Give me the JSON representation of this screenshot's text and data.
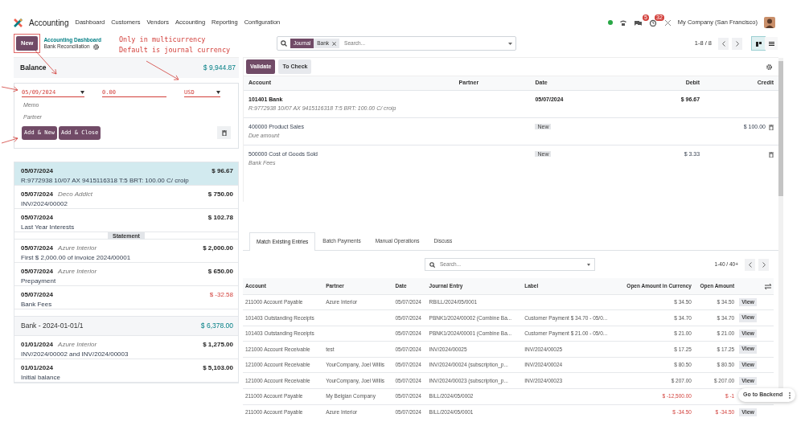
{
  "navbar": {
    "app": "Accounting",
    "menu": [
      "Dashboard",
      "Customers",
      "Vendors",
      "Accounting",
      "Reporting",
      "Configuration"
    ],
    "messages_badge": "5",
    "activities_badge": "32",
    "company": "My Company (San Francisco)"
  },
  "control_panel": {
    "new_button": "New",
    "breadcrumb": "Accounting Dashboard",
    "title": "Bank Reconciliation",
    "search": {
      "facet_label": "Journal",
      "facet_value": "Bank",
      "placeholder": "Search..."
    },
    "pager": "1-8 / 8",
    "views": [
      {
        "kind": "kanban",
        "selected": true
      },
      {
        "kind": "list",
        "selected": false
      }
    ]
  },
  "annotations": [
    "Only in multicurrency",
    "Default is journal currency"
  ],
  "balance": {
    "label": "Balance",
    "amount": "$ 9,944.87"
  },
  "new_line_form": {
    "date": "05/09/2024",
    "amount": "0.00",
    "currency": "USD",
    "memo_placeholder": "Memo",
    "partner_placeholder": "Partner",
    "buttons": [
      "Add & New",
      "Add & Close"
    ]
  },
  "statement_groups": [
    {
      "lines": [
        {
          "date": "05/07/2024",
          "label": "R:9772938 10/07 AX 9415116318 T:5 BRT: 100.00 C/ croip",
          "amount": "$ 96.67",
          "negative": false,
          "selected": true
        },
        {
          "date": "05/07/2024",
          "partner": "Deco Addict",
          "label": "INV/2024/00002",
          "amount": "$ 750.00",
          "negative": false,
          "selected": false
        },
        {
          "date": "05/07/2024",
          "label": "Last Year Interests",
          "amount": "$ 102.78",
          "negative": false,
          "selected": false
        },
        {
          "date": "05/07/2024",
          "partner": "Azure Interior",
          "label": "First $ 2,000.00 of invoice 2024/00001",
          "amount": "$ 2,000.00",
          "negative": false,
          "selected": false,
          "separator": "Statement"
        },
        {
          "date": "05/07/2024",
          "partner": "Azure Interior",
          "label": "Prepayment",
          "amount": "$ 650.00",
          "negative": false,
          "selected": false
        },
        {
          "date": "05/07/2024",
          "label": "Bank Fees",
          "amount": "$ -32.58",
          "negative": true,
          "selected": false
        }
      ]
    },
    {
      "name": "Bank - 2024-01-01/1",
      "total": "$ 6,378.00",
      "lines": [
        {
          "date": "01/01/2024",
          "partner": "Azure Interior",
          "label": "INV/2024/00002 and INV/2024/00003",
          "amount": "$ 1,275.00",
          "negative": false,
          "selected": false
        },
        {
          "date": "01/01/2024",
          "label": "Initial balance",
          "amount": "$ 5,103.00",
          "negative": false,
          "selected": false
        }
      ]
    }
  ],
  "reconcile": {
    "buttons": [
      {
        "label": "Validate",
        "kind": "primary"
      },
      {
        "label": "To Check",
        "kind": "secondary"
      }
    ],
    "columns": [
      "Account",
      "Partner",
      "Date",
      "Debit",
      "Credit"
    ],
    "lines": [
      {
        "account": "101401 Bank",
        "label": "R:9772938 10/07 AX 9415116318 T:5 BRT: 100.00 C/ croip",
        "date": "05/07/2024",
        "debit": "$ 96.67",
        "bold": true,
        "deletable": false
      },
      {
        "account": "400000 Product Sales",
        "label": "Due amount",
        "tag": "New",
        "credit": "$ 100.00",
        "bold": false,
        "deletable": true
      },
      {
        "account": "500000 Cost of Goods Sold",
        "label": "Bank Fees",
        "tag": "New",
        "debit": "$ 3.33",
        "bold": false,
        "deletable": true
      }
    ]
  },
  "tabs": [
    {
      "label": "Match Existing Entries",
      "selected": true
    },
    {
      "label": "Batch Payments",
      "selected": false
    },
    {
      "label": "Manual Operations",
      "selected": false
    },
    {
      "label": "Discuss",
      "selected": false
    }
  ],
  "match": {
    "search_placeholder": "Search...",
    "pager": "1-40 / 40+",
    "columns": [
      "Account",
      "Partner",
      "Date",
      "Journal Entry",
      "Label",
      "Open Amount in Currency",
      "Open Amount"
    ],
    "rows": [
      {
        "account": "211000 Account Payable",
        "partner": "Azure Interior",
        "date": "05/07/2024",
        "entry": "RBILL/2024/05/0001",
        "amount_currency": "$ 34.50",
        "amount": "$ 34.50",
        "negative": false,
        "view": "View"
      },
      {
        "account": "101403 Outstanding Receipts",
        "date": "05/07/2024",
        "entry": "PBNK1/2024/00002 (Combine Ba...",
        "label": "Customer Payment $ 34.70 - 05/0...",
        "amount_currency": "$ 34.70",
        "amount": "$ 34.70",
        "negative": false,
        "view": "View"
      },
      {
        "account": "101403 Outstanding Receipts",
        "date": "05/07/2024",
        "entry": "PBNK1/2024/00001 (Combine Ba...",
        "label": "Customer Payment $ 21.00 - 05/0...",
        "amount_currency": "$ 21.00",
        "amount": "$ 21.00",
        "negative": false,
        "view": "View"
      },
      {
        "account": "121000 Account Receivable",
        "partner": "test",
        "date": "05/07/2024",
        "entry": "INV/2024/00025",
        "label": "INV/2024/00025",
        "amount_currency": "$ 17.25",
        "amount": "$ 17.25",
        "negative": false,
        "view": "View"
      },
      {
        "account": "121000 Account Receivable",
        "partner": "YourCompany, Joel Willis",
        "date": "05/07/2024",
        "entry": "INV/2024/00024 (subscription_p...",
        "label": "INV/2024/00024",
        "amount_currency": "$ 80.50",
        "amount": "$ 80.50",
        "negative": false,
        "view": "View"
      },
      {
        "account": "121000 Account Receivable",
        "partner": "YourCompany, Joel Willis",
        "date": "05/07/2024",
        "entry": "INV/2024/00023 (subscription_p...",
        "label": "INV/2024/00023",
        "amount_currency": "$ 207.00",
        "amount": "$ 207.00",
        "negative": false,
        "view": "View"
      },
      {
        "account": "211000 Account Payable",
        "partner": "My Belgian Company",
        "date": "05/07/2024",
        "entry": "BILL/2024/05/0002",
        "amount_currency": "$ -12,500.00",
        "amount": "$ -1",
        "negative": true
      },
      {
        "account": "211000 Account Payable",
        "partner": "Azure Interior",
        "date": "05/07/2024",
        "entry": "BILL/2024/05/0001",
        "amount_currency": "$ -34.50",
        "amount": "$ -34.50",
        "negative": true,
        "view": "View"
      }
    ]
  },
  "backend_popup": {
    "label": "Go to Backend"
  }
}
